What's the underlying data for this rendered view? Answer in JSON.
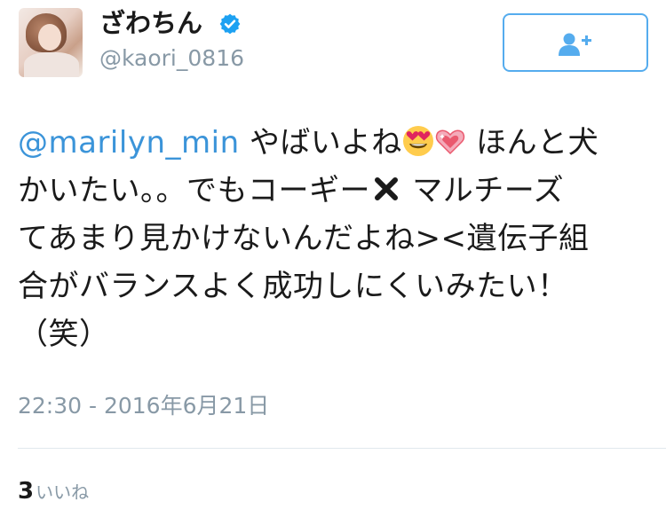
{
  "user": {
    "display_name": "ざわちん",
    "handle": "@kaori_0816",
    "verified": true,
    "avatar_icon": "profile-photo"
  },
  "follow_button": {
    "icon": "add-user-icon",
    "color": "#55acee"
  },
  "tweet": {
    "mention": "@marilyn_min",
    "line1_after_mention": " やばいよね",
    "emoji_face": "smiling-face-with-heart-eyes",
    "emoji_heart": "sparkling-heart",
    "line1_end": " ほんと犬",
    "line2_start": "かいたい。。でもコーギー",
    "emoji_cross": "heavy-multiplication-x",
    "line2_end": " マルチーズ",
    "line3": "てあまり見かけないんだよね><遺伝子組",
    "line4": "合がバランスよく成功しにくいみたい！",
    "line5": "（笑）",
    "timestamp": "22:30 - 2016年6月21日"
  },
  "stats": {
    "like_count": "3",
    "like_label": "いいね"
  },
  "colors": {
    "link": "#3b94d9",
    "secondary_text": "#8899a6",
    "divider": "#e1e8ed"
  }
}
